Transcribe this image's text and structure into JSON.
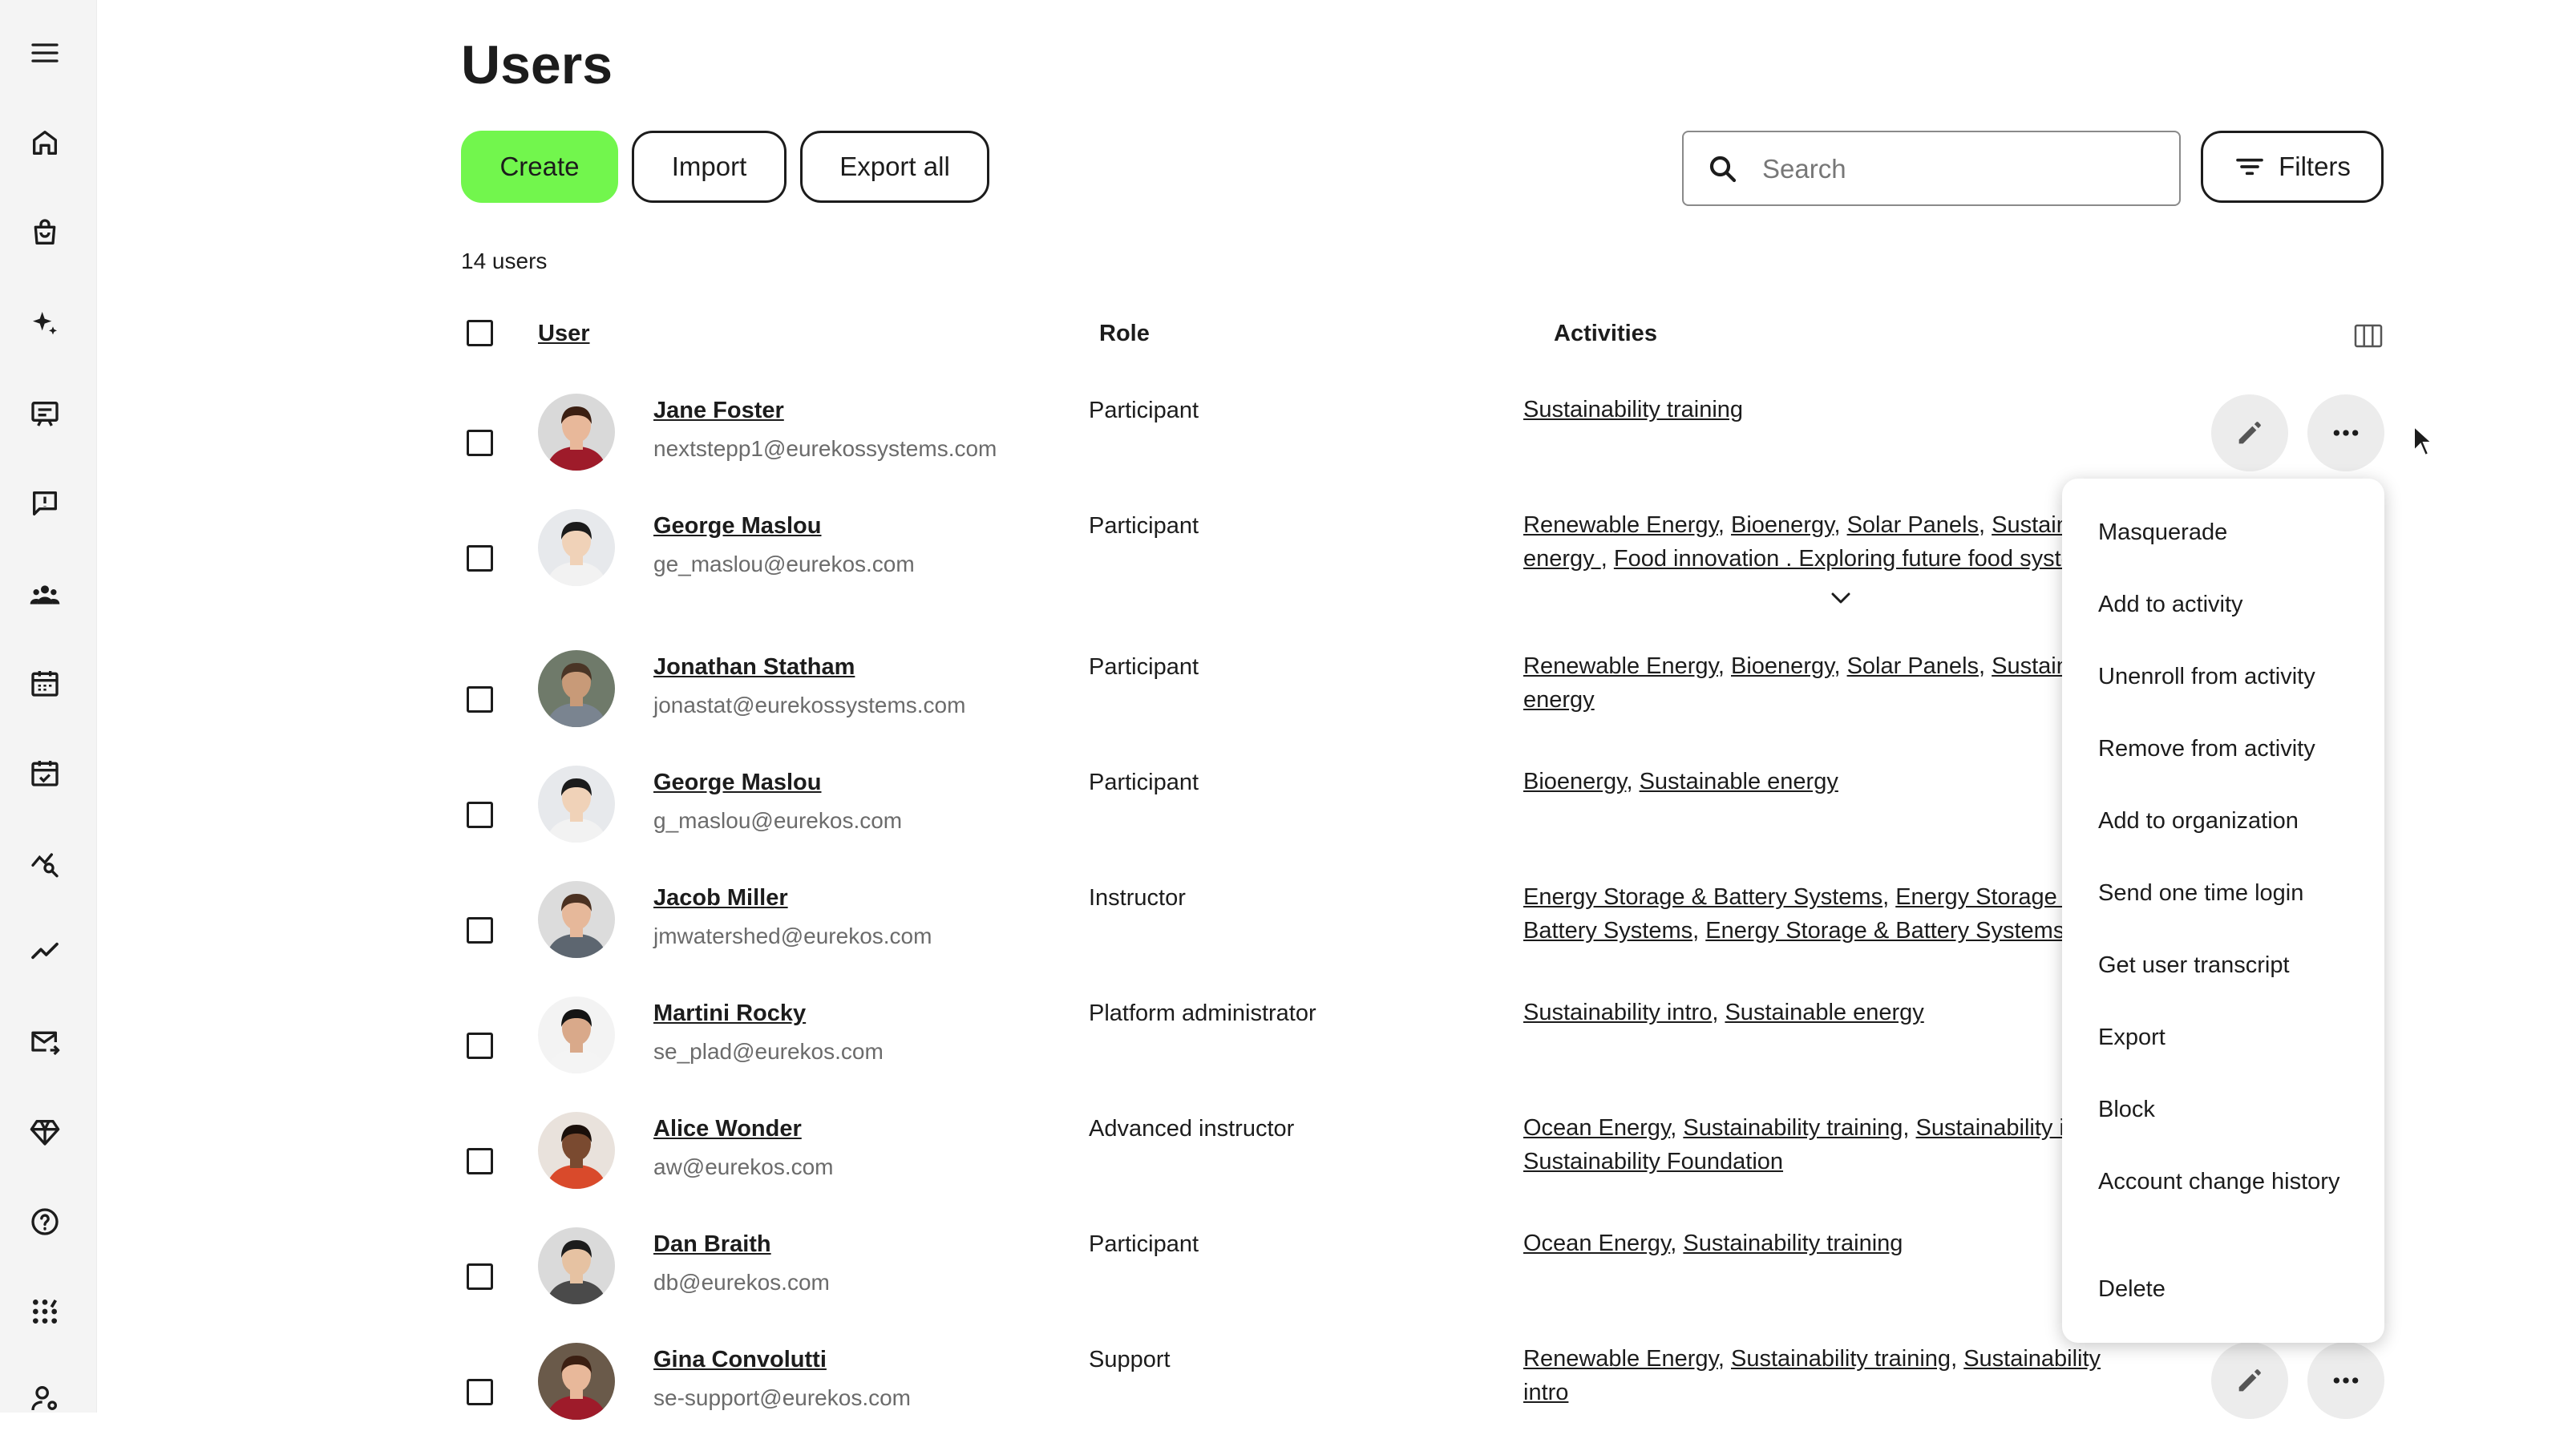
{
  "page": {
    "title": "Users"
  },
  "toolbar": {
    "create_label": "Create",
    "import_label": "Import",
    "export_label": "Export all",
    "search_placeholder": "Search",
    "filters_label": "Filters"
  },
  "summary": {
    "count_text": "14 users"
  },
  "table": {
    "headers": {
      "user": "User",
      "role": "Role",
      "activities": "Activities"
    },
    "rows": [
      {
        "name": "Jane Foster",
        "email": "nextstepp1@eurekossystems.com",
        "role": "Participant",
        "activities": [
          "Sustainability training"
        ]
      },
      {
        "name": "George Maslou",
        "email": "ge_maslou@eurekos.com",
        "role": "Participant",
        "activities": [
          "Renewable Energy",
          "Bioenergy",
          "Solar Panels",
          "Sustainable energy ",
          "Food innovation . Exploring future food systems"
        ]
      },
      {
        "name": "Jonathan Statham",
        "email": "jonastat@eurekossystems.com",
        "role": "Participant",
        "activities": [
          "Renewable Energy",
          "Bioenergy",
          "Solar Panels",
          "Sustainable energy"
        ]
      },
      {
        "name": "George Maslou",
        "email": "g_maslou@eurekos.com",
        "role": "Participant",
        "activities": [
          "Bioenergy",
          "Sustainable energy"
        ]
      },
      {
        "name": "Jacob Miller",
        "email": "jmwatershed@eurekos.com",
        "role": "Instructor",
        "activities": [
          "Energy Storage & Battery Systems",
          "Energy Storage & Battery Systems",
          "Energy Storage & Battery Systems"
        ]
      },
      {
        "name": "Martini Rocky",
        "email": "se_plad@eurekos.com",
        "role": "Platform administrator",
        "activities": [
          "Sustainability intro",
          "Sustainable energy"
        ]
      },
      {
        "name": "Alice Wonder",
        "email": "aw@eurekos.com",
        "role": "Advanced instructor",
        "activities": [
          "Ocean Energy",
          "Sustainability training",
          "Sustainability intro",
          "Sustainability Foundation"
        ]
      },
      {
        "name": "Dan Braith",
        "email": "db@eurekos.com",
        "role": "Participant",
        "activities": [
          "Ocean Energy",
          "Sustainability training"
        ]
      },
      {
        "name": "Gina Convolutti",
        "email": "se-support@eurekos.com",
        "role": "Support",
        "activities": [
          "Renewable Energy",
          "Sustainability training",
          "Sustainability intro"
        ]
      }
    ]
  },
  "menu": {
    "items": [
      "Masquerade",
      "Add to activity",
      "Unenroll from activity",
      "Remove from activity",
      "Add to organization",
      "Send one time login",
      "Get user transcript",
      "Export",
      "Block",
      "Account change history",
      "Delete"
    ]
  },
  "sidebar": {
    "icons": [
      "menu-icon",
      "home-icon",
      "shopping-bag-icon",
      "sparkles-icon",
      "presentation-icon",
      "feedback-icon",
      "groups-icon",
      "calendar-icon",
      "calendar-check-icon",
      "analytics-search-icon",
      "trend-icon",
      "mail-forward-icon",
      "diamond-icon",
      "help-icon",
      "apps-icon",
      "user-settings-icon"
    ]
  },
  "colors": {
    "accent": "#72f64d",
    "text": "#1c1c1c",
    "muted": "#6b6b6b",
    "sidebar_bg": "#f4f4f4"
  },
  "avatars": [
    {
      "skin": "#e8b89a",
      "hair": "#3b1f12",
      "shirt": "#9e1b2a",
      "bg": "#d9d9d9"
    },
    {
      "skin": "#f0d2b8",
      "hair": "#1b1b1b",
      "shirt": "#f2f2f2",
      "bg": "#e7e9ec"
    },
    {
      "skin": "#c89a78",
      "hair": "#4a3526",
      "shirt": "#7a8490",
      "bg": "#6f7a6a"
    },
    {
      "skin": "#f0d2b8",
      "hair": "#1b1b1b",
      "shirt": "#f2f2f2",
      "bg": "#e7e9ec"
    },
    {
      "skin": "#e6b89a",
      "hair": "#4b3121",
      "shirt": "#5d6670",
      "bg": "#dcdcdc"
    },
    {
      "skin": "#d9a98a",
      "hair": "#141414",
      "shirt": "#f4f4f4",
      "bg": "#f3f3f3"
    },
    {
      "skin": "#7a4a30",
      "hair": "#1a0f0a",
      "shirt": "#d94a2b",
      "bg": "#e9e2dc"
    },
    {
      "skin": "#e6c2a2",
      "hair": "#1c1c1c",
      "shirt": "#4a4a4a",
      "bg": "#dadada"
    },
    {
      "skin": "#e8b89a",
      "hair": "#3b1f12",
      "shirt": "#9e1b2a",
      "bg": "#6a5a4a"
    }
  ]
}
